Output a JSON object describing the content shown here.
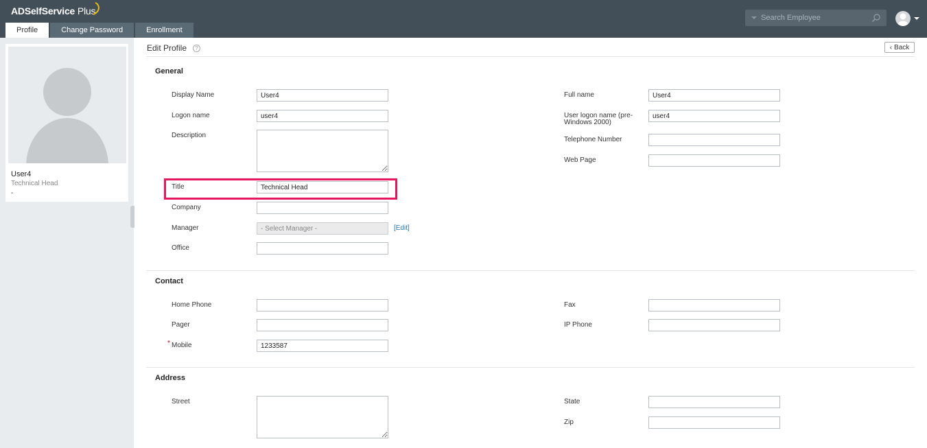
{
  "app": {
    "title": "ADSelfService",
    "title_suffix": "Plus"
  },
  "tabs": [
    {
      "label": "Profile",
      "active": true
    },
    {
      "label": "Change Password",
      "active": false
    },
    {
      "label": "Enrollment",
      "active": false
    }
  ],
  "search": {
    "placeholder": "Search Employee"
  },
  "user_card": {
    "name": "User4",
    "title": "Technical Head",
    "extra": "-"
  },
  "page": {
    "title": "Edit Profile",
    "help": "?",
    "back_label": "Back"
  },
  "sections": {
    "general": {
      "title": "General",
      "display_name": {
        "label": "Display Name",
        "value": "User4"
      },
      "logon_name": {
        "label": "Logon name",
        "value": "user4"
      },
      "description": {
        "label": "Description",
        "value": ""
      },
      "title_field": {
        "label": "Title",
        "value": "Technical Head"
      },
      "company": {
        "label": "Company",
        "value": ""
      },
      "manager": {
        "label": "Manager",
        "value": "- Select Manager -",
        "edit_link": "[Edit]"
      },
      "office": {
        "label": "Office",
        "value": ""
      },
      "full_name": {
        "label": "Full name",
        "value": "User4"
      },
      "user_logon_pre2000": {
        "label_line1": "User logon name (pre-",
        "label_line2": "Windows 2000)",
        "value": "user4"
      },
      "telephone": {
        "label": "Telephone Number",
        "value": ""
      },
      "web_page": {
        "label": "Web Page",
        "value": ""
      }
    },
    "contact": {
      "title": "Contact",
      "home_phone": {
        "label": "Home Phone",
        "value": ""
      },
      "pager": {
        "label": "Pager",
        "value": ""
      },
      "mobile": {
        "label": "Mobile",
        "value": "1233587",
        "required": "*"
      },
      "fax": {
        "label": "Fax",
        "value": ""
      },
      "ip_phone": {
        "label": "IP Phone",
        "value": ""
      }
    },
    "address": {
      "title": "Address",
      "street": {
        "label": "Street",
        "value": ""
      },
      "state": {
        "label": "State",
        "value": ""
      },
      "zip": {
        "label": "Zip",
        "value": ""
      }
    }
  },
  "colors": {
    "topbar": "#434f58",
    "tab_inactive": "#5b6b76",
    "highlight": "#e5185f",
    "link": "#2a78b4",
    "logo_arc": "#e8b81a"
  }
}
